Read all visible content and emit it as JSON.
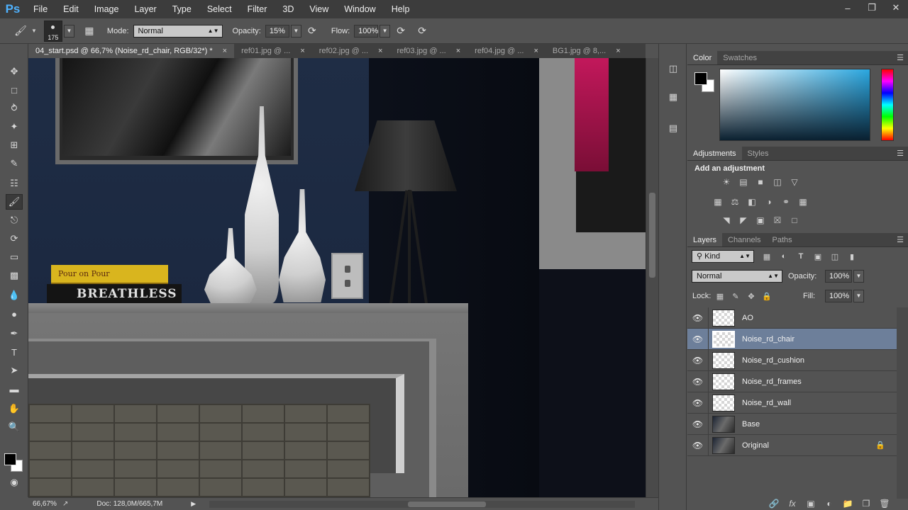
{
  "app": {
    "logo": "Ps",
    "menu": [
      "File",
      "Edit",
      "Image",
      "Layer",
      "Type",
      "Select",
      "Filter",
      "3D",
      "View",
      "Window",
      "Help"
    ],
    "window_controls": [
      "minimize",
      "restore",
      "close"
    ]
  },
  "options_bar": {
    "brush_size": "175",
    "mode_label": "Mode:",
    "mode_value": "Normal",
    "opacity_label": "Opacity:",
    "opacity_value": "15%",
    "flow_label": "Flow:",
    "flow_value": "100%"
  },
  "tabs": [
    {
      "label": "04_start.psd @ 66,7% (Noise_rd_chair, RGB/32*) *",
      "active": true
    },
    {
      "label": "ref01.jpg @ ...",
      "active": false
    },
    {
      "label": "ref02.jpg @ ...",
      "active": false
    },
    {
      "label": "ref03.jpg @ ...",
      "active": false
    },
    {
      "label": "ref04.jpg @ ...",
      "active": false
    },
    {
      "label": "BG1.jpg @ 8,...",
      "active": false
    }
  ],
  "tab_close_glyph": "×",
  "canvas": {
    "book_spine_text": "BREATHLESS",
    "book_top_text": "Pour on Pour"
  },
  "status_bar": {
    "zoom": "66,67%",
    "doc": "Doc: 128,0M/665,7M"
  },
  "panels": {
    "color_tabs": [
      "Color",
      "Swatches"
    ],
    "adjustment_tabs": [
      "Adjustments",
      "Styles"
    ],
    "adjustments_title": "Add an adjustment",
    "layers_tabs": [
      "Layers",
      "Channels",
      "Paths"
    ],
    "filter_kind": "Kind",
    "blend_mode": "Normal",
    "opacity_label": "Opacity:",
    "opacity_value": "100%",
    "lock_label": "Lock:",
    "fill_label": "Fill:",
    "fill_value": "100%"
  },
  "layers": [
    {
      "name": "AO",
      "thumb": "transparent",
      "selected": false,
      "locked": false
    },
    {
      "name": "Noise_rd_chair",
      "thumb": "transparent",
      "selected": true,
      "locked": false
    },
    {
      "name": "Noise_rd_cushion",
      "thumb": "transparent",
      "selected": false,
      "locked": false
    },
    {
      "name": "Noise_rd_frames",
      "thumb": "transparent",
      "selected": false,
      "locked": false
    },
    {
      "name": "Noise_rd_wall",
      "thumb": "transparent",
      "selected": false,
      "locked": false
    },
    {
      "name": "Base",
      "thumb": "photo",
      "selected": false,
      "locked": false
    },
    {
      "name": "Original",
      "thumb": "photo",
      "selected": false,
      "locked": true
    }
  ],
  "colors": {
    "accent": "#4fb2ff",
    "selected_layer": "#6d7f9a",
    "foreground": "#000000",
    "background": "#ffffff"
  }
}
